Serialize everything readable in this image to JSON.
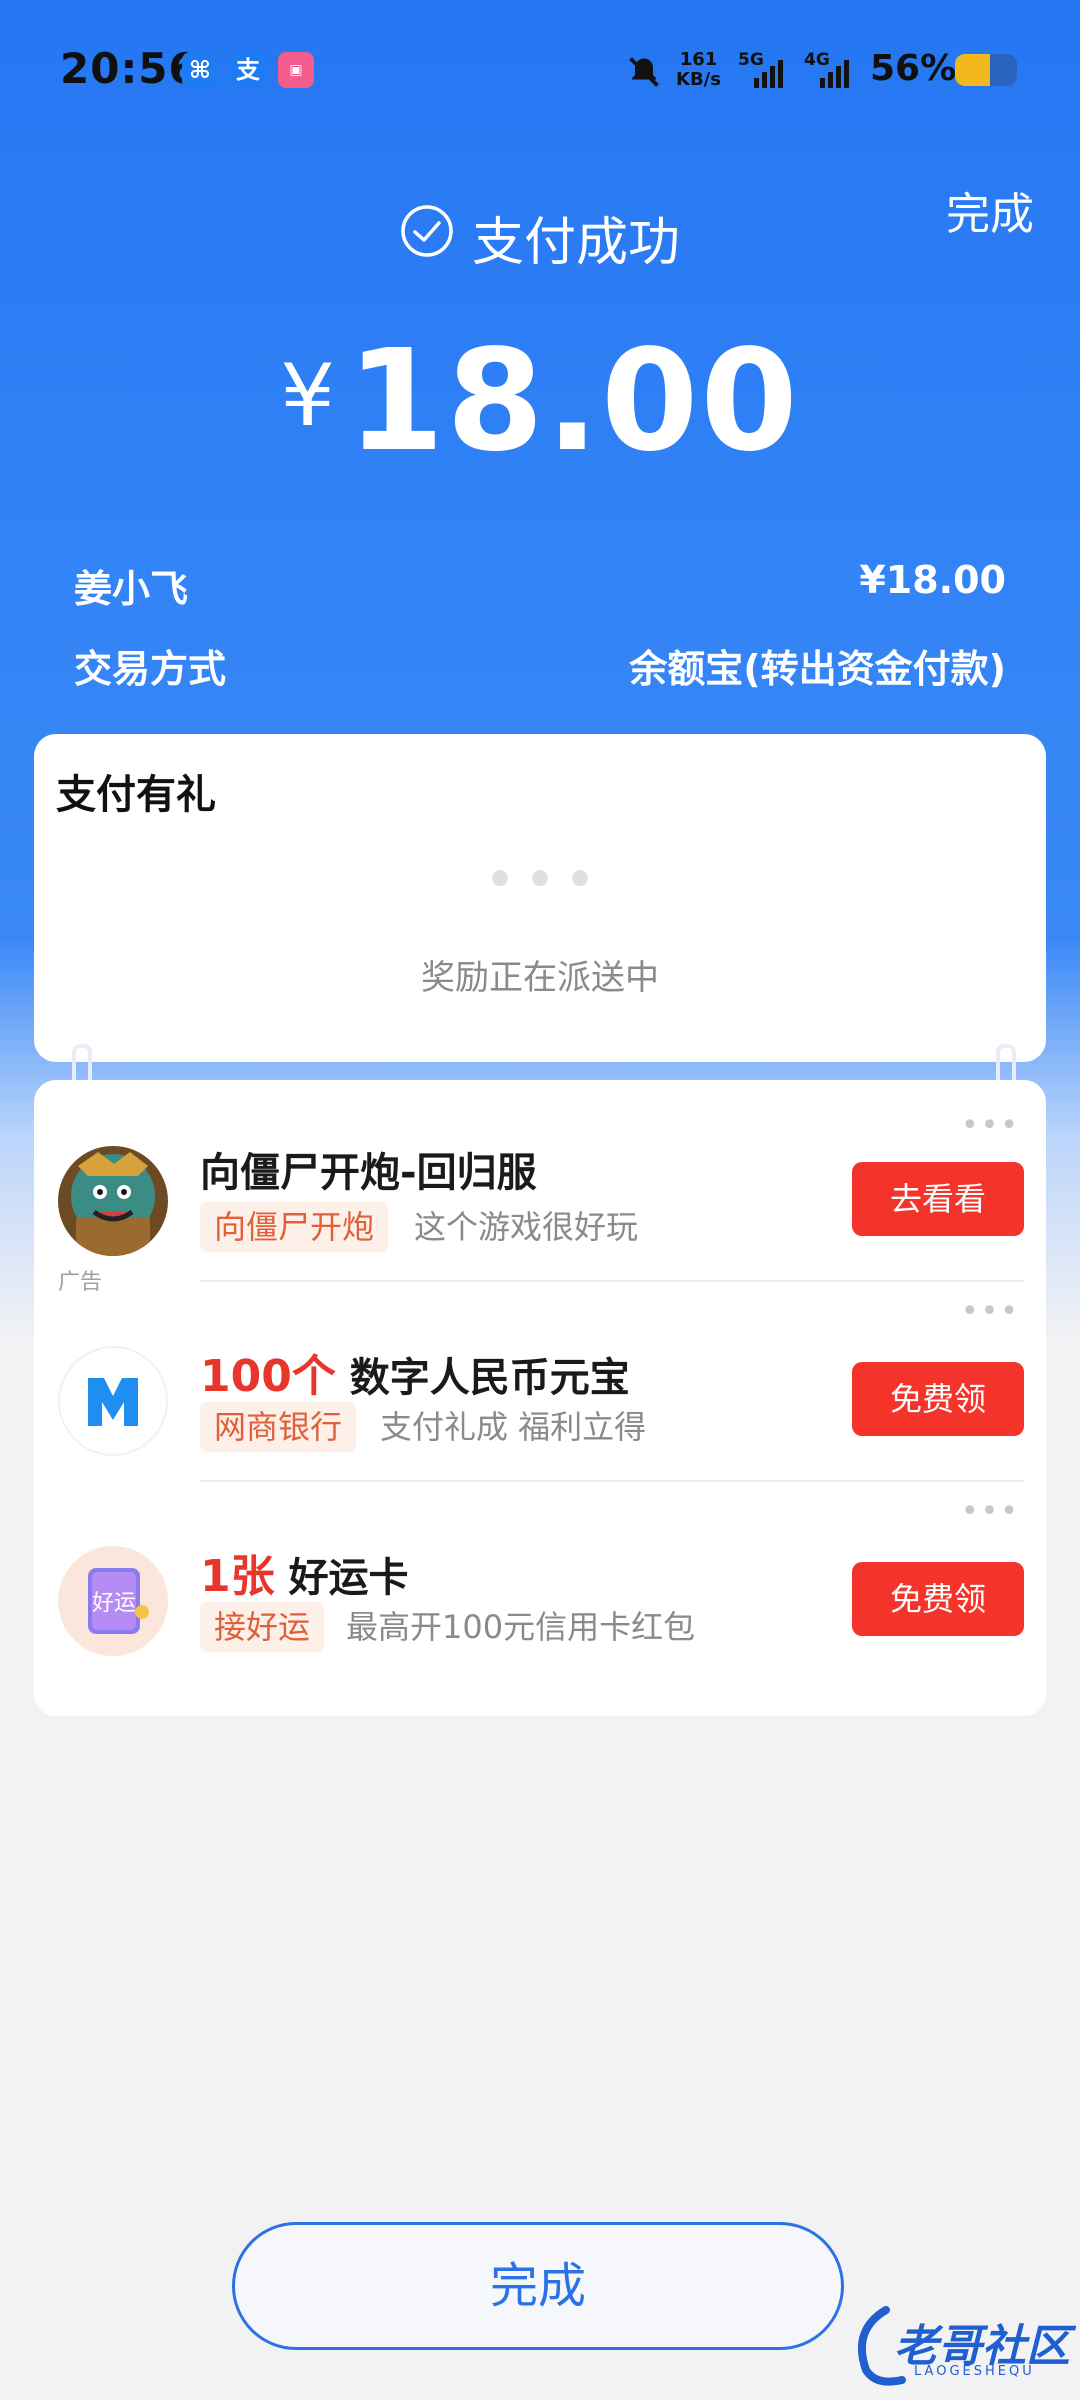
{
  "status_bar": {
    "time": "20:56",
    "speed_value": "161",
    "speed_unit": "KB/s",
    "net1": "5G",
    "net2": "4G",
    "battery_pct": "56%",
    "battery_level": 0.56
  },
  "header": {
    "done_label": "完成",
    "success_text": "支付成功",
    "currency_symbol": "¥",
    "amount": "18.00"
  },
  "details": {
    "payee": "姜小飞",
    "payee_amount": "¥18.00",
    "method_label": "交易方式",
    "method_value": "余额宝(转出资金付款)"
  },
  "reward_card": {
    "title": "支付有礼",
    "message": "奖励正在派送中"
  },
  "offers": [
    {
      "highlight": "",
      "title": "向僵尸开炮-回归服",
      "tag": "向僵尸开炮",
      "desc": "这个游戏很好玩",
      "button": "去看看",
      "ad_label": "广告"
    },
    {
      "highlight": "100个",
      "title": "数字人民币元宝",
      "tag": "网商银行",
      "desc": "支付礼成 福利立得",
      "button": "免费领"
    },
    {
      "highlight": "1张",
      "title": "好运卡",
      "tag": "接好运",
      "desc": "最高开100元信用卡红包",
      "button": "免费领"
    }
  ],
  "footer": {
    "done_label": "完成"
  },
  "watermark": {
    "text": "老哥社区",
    "sub": "LAOGESHEQU"
  },
  "colors": {
    "primary_blue": "#2576f2",
    "button_red": "#f4332a",
    "highlight_red": "#e8362c"
  }
}
